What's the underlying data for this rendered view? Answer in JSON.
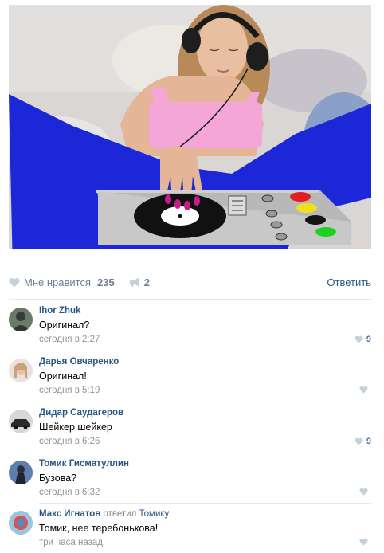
{
  "post": {
    "image_alt": "",
    "likes_label": "Мне нравится",
    "likes_count": "235",
    "shares_count": "2",
    "reply_label": "Ответить"
  },
  "comments": [
    {
      "author": "Ihor Zhuk",
      "replied_to_label": "",
      "reply_target": "",
      "text": "Оригинал?",
      "date": "сегодня в 2:27",
      "likes": "9"
    },
    {
      "author": "Дарья Овчаренко",
      "replied_to_label": "",
      "reply_target": "",
      "text": "Оригинал!",
      "date": "сегодня в 5:19",
      "likes": ""
    },
    {
      "author": "Дидар Саудагеров",
      "replied_to_label": "",
      "reply_target": "",
      "text": "Шейкер шейкер",
      "date": "сегодня в 6:26",
      "likes": "9"
    },
    {
      "author": "Томик Гисматуллин",
      "replied_to_label": "",
      "reply_target": "",
      "text": "Бузова?",
      "date": "сегодня в 6:32",
      "likes": ""
    },
    {
      "author": "Макс Игнатов",
      "replied_to_label": "ответил",
      "reply_target": "Томику",
      "text": "Томик, нее теребонькова!",
      "date": "три часа назад",
      "likes": ""
    }
  ],
  "colors": {
    "link": "#2a5885",
    "muted": "#939393",
    "like_icon": "#c5d0db",
    "like_active": "#4b76a8",
    "overlay_blue": "#1c28d8",
    "overlay_pink": "#f4a6d8"
  },
  "icons": {
    "like": "heart-icon",
    "share": "megaphone-icon"
  }
}
